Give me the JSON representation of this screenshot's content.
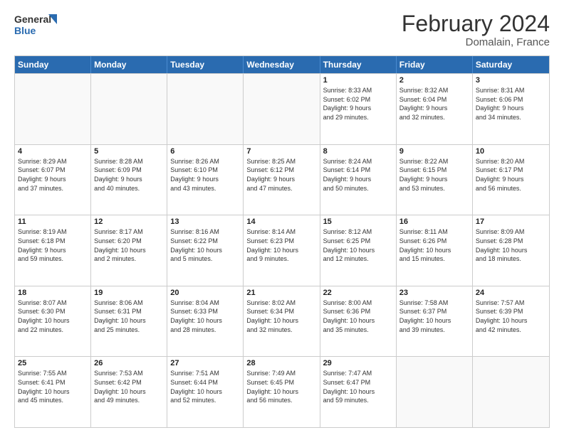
{
  "header": {
    "logo_line1": "General",
    "logo_line2": "Blue",
    "title": "February 2024",
    "subtitle": "Domalain, France"
  },
  "days_of_week": [
    "Sunday",
    "Monday",
    "Tuesday",
    "Wednesday",
    "Thursday",
    "Friday",
    "Saturday"
  ],
  "weeks": [
    [
      {
        "num": "",
        "info": ""
      },
      {
        "num": "",
        "info": ""
      },
      {
        "num": "",
        "info": ""
      },
      {
        "num": "",
        "info": ""
      },
      {
        "num": "1",
        "info": "Sunrise: 8:33 AM\nSunset: 6:02 PM\nDaylight: 9 hours\nand 29 minutes."
      },
      {
        "num": "2",
        "info": "Sunrise: 8:32 AM\nSunset: 6:04 PM\nDaylight: 9 hours\nand 32 minutes."
      },
      {
        "num": "3",
        "info": "Sunrise: 8:31 AM\nSunset: 6:06 PM\nDaylight: 9 hours\nand 34 minutes."
      }
    ],
    [
      {
        "num": "4",
        "info": "Sunrise: 8:29 AM\nSunset: 6:07 PM\nDaylight: 9 hours\nand 37 minutes."
      },
      {
        "num": "5",
        "info": "Sunrise: 8:28 AM\nSunset: 6:09 PM\nDaylight: 9 hours\nand 40 minutes."
      },
      {
        "num": "6",
        "info": "Sunrise: 8:26 AM\nSunset: 6:10 PM\nDaylight: 9 hours\nand 43 minutes."
      },
      {
        "num": "7",
        "info": "Sunrise: 8:25 AM\nSunset: 6:12 PM\nDaylight: 9 hours\nand 47 minutes."
      },
      {
        "num": "8",
        "info": "Sunrise: 8:24 AM\nSunset: 6:14 PM\nDaylight: 9 hours\nand 50 minutes."
      },
      {
        "num": "9",
        "info": "Sunrise: 8:22 AM\nSunset: 6:15 PM\nDaylight: 9 hours\nand 53 minutes."
      },
      {
        "num": "10",
        "info": "Sunrise: 8:20 AM\nSunset: 6:17 PM\nDaylight: 9 hours\nand 56 minutes."
      }
    ],
    [
      {
        "num": "11",
        "info": "Sunrise: 8:19 AM\nSunset: 6:18 PM\nDaylight: 9 hours\nand 59 minutes."
      },
      {
        "num": "12",
        "info": "Sunrise: 8:17 AM\nSunset: 6:20 PM\nDaylight: 10 hours\nand 2 minutes."
      },
      {
        "num": "13",
        "info": "Sunrise: 8:16 AM\nSunset: 6:22 PM\nDaylight: 10 hours\nand 5 minutes."
      },
      {
        "num": "14",
        "info": "Sunrise: 8:14 AM\nSunset: 6:23 PM\nDaylight: 10 hours\nand 9 minutes."
      },
      {
        "num": "15",
        "info": "Sunrise: 8:12 AM\nSunset: 6:25 PM\nDaylight: 10 hours\nand 12 minutes."
      },
      {
        "num": "16",
        "info": "Sunrise: 8:11 AM\nSunset: 6:26 PM\nDaylight: 10 hours\nand 15 minutes."
      },
      {
        "num": "17",
        "info": "Sunrise: 8:09 AM\nSunset: 6:28 PM\nDaylight: 10 hours\nand 18 minutes."
      }
    ],
    [
      {
        "num": "18",
        "info": "Sunrise: 8:07 AM\nSunset: 6:30 PM\nDaylight: 10 hours\nand 22 minutes."
      },
      {
        "num": "19",
        "info": "Sunrise: 8:06 AM\nSunset: 6:31 PM\nDaylight: 10 hours\nand 25 minutes."
      },
      {
        "num": "20",
        "info": "Sunrise: 8:04 AM\nSunset: 6:33 PM\nDaylight: 10 hours\nand 28 minutes."
      },
      {
        "num": "21",
        "info": "Sunrise: 8:02 AM\nSunset: 6:34 PM\nDaylight: 10 hours\nand 32 minutes."
      },
      {
        "num": "22",
        "info": "Sunrise: 8:00 AM\nSunset: 6:36 PM\nDaylight: 10 hours\nand 35 minutes."
      },
      {
        "num": "23",
        "info": "Sunrise: 7:58 AM\nSunset: 6:37 PM\nDaylight: 10 hours\nand 39 minutes."
      },
      {
        "num": "24",
        "info": "Sunrise: 7:57 AM\nSunset: 6:39 PM\nDaylight: 10 hours\nand 42 minutes."
      }
    ],
    [
      {
        "num": "25",
        "info": "Sunrise: 7:55 AM\nSunset: 6:41 PM\nDaylight: 10 hours\nand 45 minutes."
      },
      {
        "num": "26",
        "info": "Sunrise: 7:53 AM\nSunset: 6:42 PM\nDaylight: 10 hours\nand 49 minutes."
      },
      {
        "num": "27",
        "info": "Sunrise: 7:51 AM\nSunset: 6:44 PM\nDaylight: 10 hours\nand 52 minutes."
      },
      {
        "num": "28",
        "info": "Sunrise: 7:49 AM\nSunset: 6:45 PM\nDaylight: 10 hours\nand 56 minutes."
      },
      {
        "num": "29",
        "info": "Sunrise: 7:47 AM\nSunset: 6:47 PM\nDaylight: 10 hours\nand 59 minutes."
      },
      {
        "num": "",
        "info": ""
      },
      {
        "num": "",
        "info": ""
      }
    ]
  ]
}
